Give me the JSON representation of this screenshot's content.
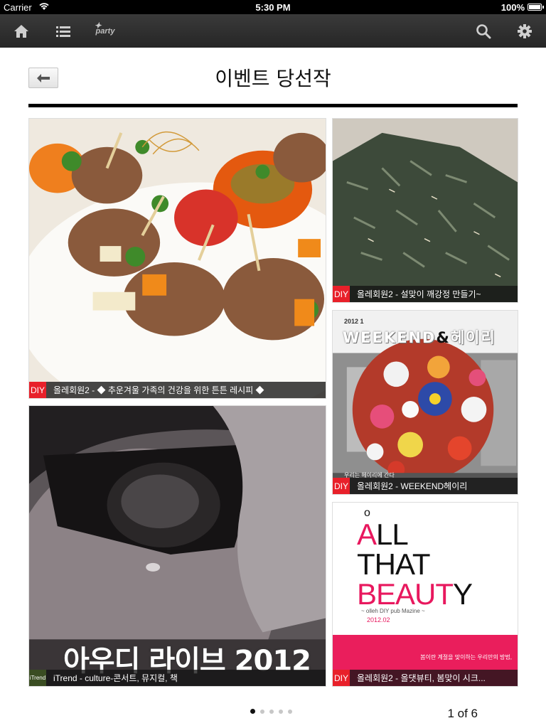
{
  "status_bar": {
    "carrier": "Carrier",
    "time": "5:30 PM",
    "battery": "100%",
    "battery_level": 1.0
  },
  "navbar": {
    "logo_text": "party",
    "icons": [
      "home-icon",
      "list-icon",
      "party-logo",
      "search-icon",
      "settings-icon"
    ]
  },
  "header": {
    "title": "이벤트 당선작",
    "back_icon": "arrow-left-icon"
  },
  "tiles": [
    {
      "badge": "DIY",
      "caption": "올레회원2 - ◆ 추운겨울 가족의 건강을 위한 튼튼 레시피 ◆"
    },
    {
      "badge": "DIY",
      "caption": "올레회원2 - 설맞이 깨강정 만들기~"
    },
    {
      "badge": "DIY",
      "caption": "올레회원2 - WEEKEND헤이리"
    },
    {
      "badge": "iTrend",
      "caption": "iTrend - culture-콘서트, 뮤지컬, 책"
    },
    {
      "badge": "DIY",
      "caption": "올레회원2 - 올댓뷰티, 봄맞이 시크..."
    }
  ],
  "tile_art": {
    "weekend_year": "2012  1",
    "weekend_title_a": "WEEKEND",
    "weekend_title_amp": "&",
    "weekend_title_b": "헤이리",
    "weekend_note": "우리는 헤이리에 간다",
    "live_text": "아우디 라이브 2012",
    "beauty_o": "o",
    "beauty_line1_a": "A",
    "beauty_line1_b": "LL",
    "beauty_line2": "THAT",
    "beauty_line3_a": "BEAUT",
    "beauty_line3_b": "Y",
    "beauty_sub": "~ olleh DIY pub Mazine ~",
    "beauty_date": "2012.02",
    "beauty_band_text": "봄이란 계절을 맞이하는 우리만의 방법,"
  },
  "pager": {
    "total_dots": 5,
    "active_index": 0,
    "page_label": "1 of 6"
  },
  "colors": {
    "navbar": "#2f2f2f",
    "badge_diy": "#e8202a",
    "beauty_pink": "#e8185e"
  }
}
